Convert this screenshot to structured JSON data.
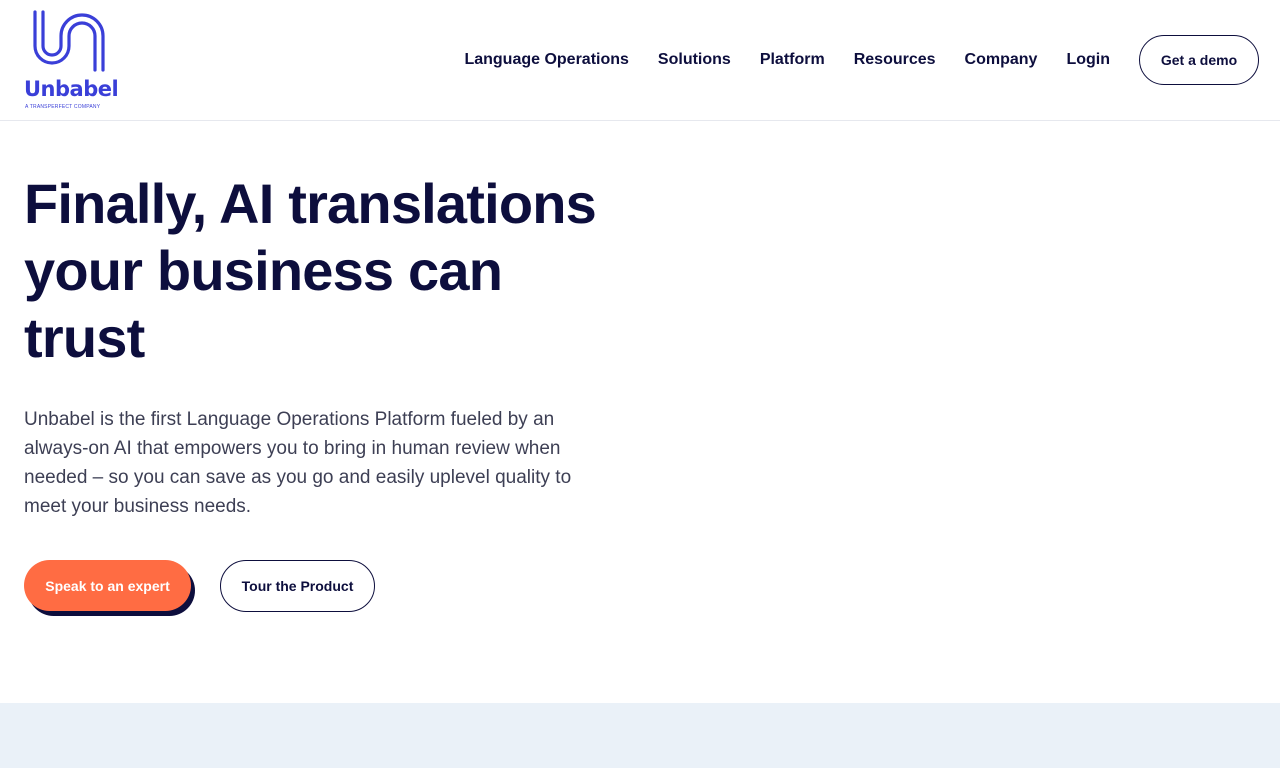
{
  "brand": {
    "name": "Unbabel",
    "tagline": "A TRANSPERFECT COMPANY",
    "color": "#3a3fd8"
  },
  "nav": {
    "items": [
      {
        "label": "Language Operations"
      },
      {
        "label": "Solutions"
      },
      {
        "label": "Platform"
      },
      {
        "label": "Resources"
      },
      {
        "label": "Company"
      },
      {
        "label": "Login"
      }
    ],
    "cta_label": "Get a demo"
  },
  "hero": {
    "title": "Finally, AI translations your business can trust",
    "subtitle": "Unbabel is the first Language Operations Platform fueled by an always-on AI that empowers you to bring in human review when needed – so you can save as you go and easily uplevel quality to meet your business needs.",
    "primary_cta": "Speak to an expert",
    "secondary_cta": "Tour the Product"
  },
  "colors": {
    "navy": "#0d0e3d",
    "accent": "#ff6c43",
    "band": "#eaf1f8"
  }
}
